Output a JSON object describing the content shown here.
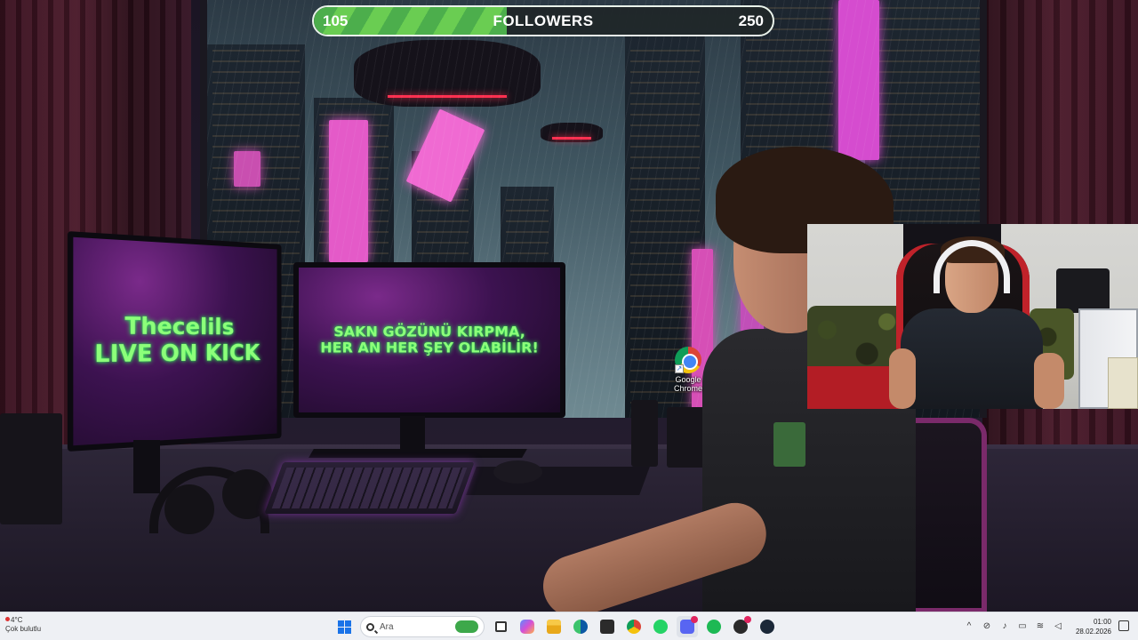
{
  "stream_overlay": {
    "followers": {
      "current": "105",
      "label": "FOLLOWERS",
      "goal": "250",
      "progress_fraction": 0.42,
      "bar_color": "#5fbf4c"
    }
  },
  "wallpaper": {
    "monitor_left_text": [
      "Thecelils",
      "LIVE ON KICK"
    ],
    "monitor_right_text": [
      "SAKN GÖZÜNÜ KIRPMA,",
      "HER AN HER ŞEY OLABİLİR!"
    ]
  },
  "desktop_icons": [
    {
      "name": "chrome-shortcut",
      "label_line1": "Google",
      "label_line2": "Chrome",
      "icon": "chrome-icon"
    }
  ],
  "taskbar": {
    "weather": {
      "temp": "4°C",
      "desc": "Çok bulutlu"
    },
    "search_placeholder": "Ara",
    "apps": [
      {
        "id": "start",
        "icon": "windows-icon"
      },
      {
        "id": "task-view",
        "icon": "task-view-icon"
      },
      {
        "id": "copilot",
        "icon": "copilot-icon"
      },
      {
        "id": "file-explorer",
        "icon": "folder-icon"
      },
      {
        "id": "edge",
        "icon": "edge-icon"
      },
      {
        "id": "store",
        "icon": "store-icon"
      },
      {
        "id": "chrome",
        "icon": "chrome-icon"
      },
      {
        "id": "whatsapp",
        "icon": "whatsapp-icon"
      },
      {
        "id": "discord",
        "icon": "discord-icon",
        "badge": true
      },
      {
        "id": "spotify",
        "icon": "spotify-icon"
      },
      {
        "id": "obs",
        "icon": "obs-icon",
        "badge": true
      },
      {
        "id": "steam",
        "icon": "steam-icon"
      }
    ],
    "tray": {
      "time": "01:00",
      "date": "28.02.2026"
    }
  }
}
